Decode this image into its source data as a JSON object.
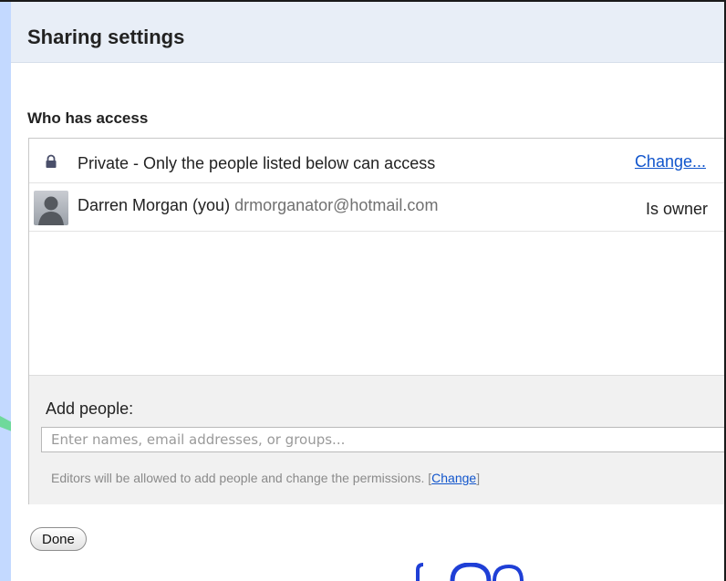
{
  "dialog": {
    "title": "Sharing settings"
  },
  "access": {
    "heading": "Who has access",
    "visibility": {
      "icon": "lock-icon",
      "text": "Private - Only the people listed below can access",
      "change_label": "Change..."
    },
    "people": [
      {
        "icon": "person-avatar",
        "name": "Darren Morgan (you)",
        "email": "drmorganator@hotmail.com",
        "role": "Is owner"
      }
    ]
  },
  "add_people": {
    "label": "Add people:",
    "placeholder": "Enter names, email addresses, or groups...",
    "editors_note": "Editors will be allowed to add people and change the permissions.",
    "editors_bracket_open": "[",
    "editors_change_label": "Change",
    "editors_bracket_close": "]"
  },
  "footer": {
    "done_label": "Done"
  },
  "colors": {
    "header_bg": "#e8eef7",
    "link": "#1155cc",
    "strip": "#c3d9ff",
    "arrow": "#5fd88a",
    "logo": "#1f3fd6"
  }
}
